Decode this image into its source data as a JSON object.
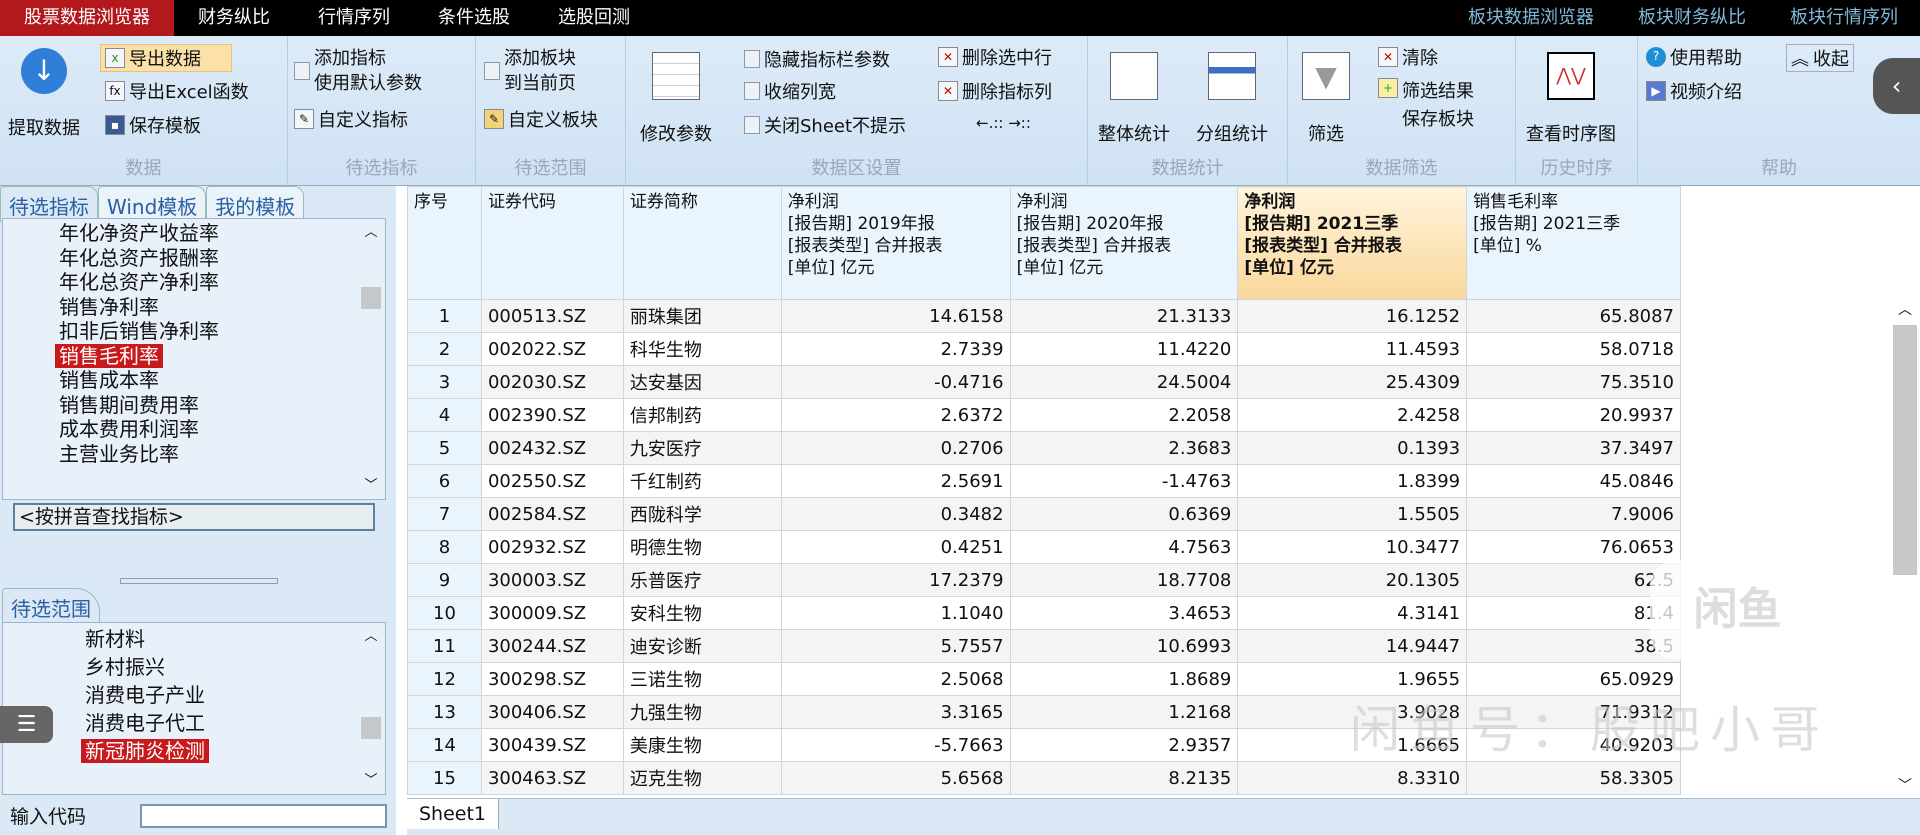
{
  "menu": {
    "tabs": [
      "股票数据浏览器",
      "财务纵比",
      "行情序列",
      "条件选股",
      "选股回测"
    ],
    "right_tabs": [
      "板块数据浏览器",
      "板块财务纵比",
      "板块行情序列"
    ]
  },
  "ribbon": {
    "data": {
      "label": "数据",
      "fetch": "提取数据",
      "export": "导出数据",
      "export_excel": "导出Excel函数",
      "save_template": "保存模板"
    },
    "indicators": {
      "label": "待选指标",
      "add": "添加指标",
      "default_params": "使用默认参数",
      "custom": "自定义指标"
    },
    "range": {
      "label": "待选范围",
      "add_block": "添加板块",
      "to_page": "到当前页",
      "custom_block": "自定义板块"
    },
    "settings": {
      "label": "数据区设置",
      "modify": "修改参数",
      "hide_params": "隐藏指标栏参数",
      "shrink": "收缩列宽",
      "close_sheet": "关闭Sheet不提示",
      "del_row": "删除选中行",
      "del_col": "删除指标列",
      "move": "←.:: →::"
    },
    "stats": {
      "label": "数据统计",
      "overall": "整体统计",
      "group": "分组统计"
    },
    "filter": {
      "label": "数据筛选",
      "filter": "筛选",
      "clear": "清除",
      "save_result": "筛选结果",
      "save_block": "保存板块"
    },
    "history": {
      "label": "历史时序",
      "chart": "查看时序图"
    },
    "help": {
      "label": "帮助",
      "usage": "使用帮助",
      "video": "视频介绍",
      "collapse": "收起"
    }
  },
  "left": {
    "tabs": [
      "待选指标",
      "Wind模板",
      "我的模板"
    ],
    "indicators": [
      "年化净资产收益率",
      "年化总资产报酬率",
      "年化总资产净利率",
      "销售净利率",
      "扣非后销售净利率",
      "销售毛利率",
      "销售成本率",
      "销售期间费用率",
      "成本费用利润率",
      "主营业务比率"
    ],
    "selected_indicator": "销售毛利率",
    "search_placeholder": "<按拼音查找指标>",
    "range_tab": "待选范围",
    "ranges": [
      "新材料",
      "乡村振兴",
      "消费电子产业",
      "消费电子代工",
      "新冠肺炎检测"
    ],
    "selected_range": "新冠肺炎检测",
    "code_label": "输入代码",
    "code_value": ""
  },
  "table": {
    "headers": [
      [
        "序号"
      ],
      [
        "证券代码"
      ],
      [
        "证券简称"
      ],
      [
        "净利润",
        "[报告期] 2019年报",
        "[报表类型] 合并报表",
        "[单位] 亿元"
      ],
      [
        "净利润",
        "[报告期] 2020年报",
        "[报表类型] 合并报表",
        "[单位] 亿元"
      ],
      [
        "净利润",
        "[报告期] 2021三季",
        "[报表类型] 合并报表",
        "[单位] 亿元"
      ],
      [
        "销售毛利率",
        "[报告期] 2021三季",
        "[单位] %"
      ]
    ],
    "rows": [
      [
        "1",
        "000513.SZ",
        "丽珠集团",
        "14.6158",
        "21.3133",
        "16.1252",
        "65.8087"
      ],
      [
        "2",
        "002022.SZ",
        "科华生物",
        "2.7339",
        "11.4220",
        "11.4593",
        "58.0718"
      ],
      [
        "3",
        "002030.SZ",
        "达安基因",
        "-0.4716",
        "24.5004",
        "25.4309",
        "75.3510"
      ],
      [
        "4",
        "002390.SZ",
        "信邦制药",
        "2.6372",
        "2.2058",
        "2.4258",
        "20.9937"
      ],
      [
        "5",
        "002432.SZ",
        "九安医疗",
        "0.2706",
        "2.3683",
        "0.1393",
        "37.3497"
      ],
      [
        "6",
        "002550.SZ",
        "千红制药",
        "2.5691",
        "-1.4763",
        "1.8399",
        "45.0846"
      ],
      [
        "7",
        "002584.SZ",
        "西陇科学",
        "0.3482",
        "0.6369",
        "1.5505",
        "7.9006"
      ],
      [
        "8",
        "002932.SZ",
        "明德生物",
        "0.4251",
        "4.7563",
        "10.3477",
        "76.0653"
      ],
      [
        "9",
        "300003.SZ",
        "乐普医疗",
        "17.2379",
        "18.7708",
        "20.1305",
        "62.5"
      ],
      [
        "10",
        "300009.SZ",
        "安科生物",
        "1.1040",
        "3.4653",
        "4.3141",
        "81.4"
      ],
      [
        "11",
        "300244.SZ",
        "迪安诊断",
        "5.7557",
        "10.6993",
        "14.9447",
        "38.5"
      ],
      [
        "12",
        "300298.SZ",
        "三诺生物",
        "2.5068",
        "1.8689",
        "1.9655",
        "65.0929"
      ],
      [
        "13",
        "300406.SZ",
        "九强生物",
        "3.3165",
        "1.2168",
        "3.9028",
        "71.9312"
      ],
      [
        "14",
        "300439.SZ",
        "美康生物",
        "-5.7663",
        "2.9357",
        "1.6665",
        "40.9203"
      ],
      [
        "15",
        "300463.SZ",
        "迈克生物",
        "5.6568",
        "8.2135",
        "8.3310",
        "58.3305"
      ]
    ]
  },
  "sheet_tab": "Sheet1",
  "watermark": {
    "logo": "闲鱼",
    "text": "闲鱼号：股吧小哥"
  },
  "colors": {
    "accent": "#b3191c",
    "ribbon": "#d6e7f7",
    "highlight_header": "#fad79a"
  }
}
